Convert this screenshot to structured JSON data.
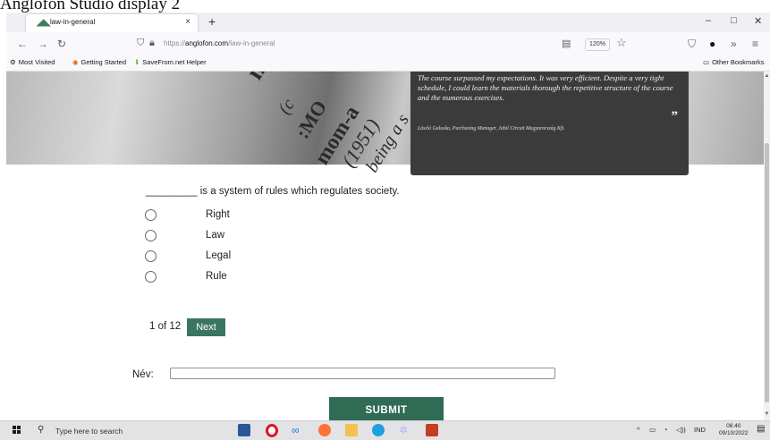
{
  "document_title": "Anglofon Studio display 2",
  "browser": {
    "tab_title": "law-in-general",
    "url_domain": "anglofon.com",
    "url_prefix": "https://",
    "url_path": "/law-in-general",
    "zoom": "120%",
    "bookmarks": [
      "Most Visited",
      "Getting Started",
      "SaveFrom.net Helper"
    ],
    "other_bookmarks": "Other Bookmarks"
  },
  "hero": {
    "quote": "The course surpassed my expectations. It was very efficient. Despite a very tight schedule, I could learn the materials thorough the repetitive structure of the course and the numerous exercises.",
    "quote_mark": "”",
    "author": "László Galuska, Purchasing Manager, Jabil Circuit Magyarország Kft."
  },
  "quiz": {
    "question": "_________ is a system of rules which regulates society.",
    "options": [
      "Right",
      "Law",
      "Legal",
      "Rule"
    ],
    "counter": "1 of 12",
    "next_label": "Next"
  },
  "form": {
    "name_label": "Név:",
    "name_value": "",
    "submit_label": "SUBMIT"
  },
  "taskbar": {
    "search_placeholder": "Type here to search",
    "language": "IND",
    "time": "08.40",
    "date": "09/10/2022"
  },
  "colors": {
    "accent_green": "#3a7560",
    "submit_green": "#2f6b55",
    "quote_bg": "#3b3b3b"
  }
}
